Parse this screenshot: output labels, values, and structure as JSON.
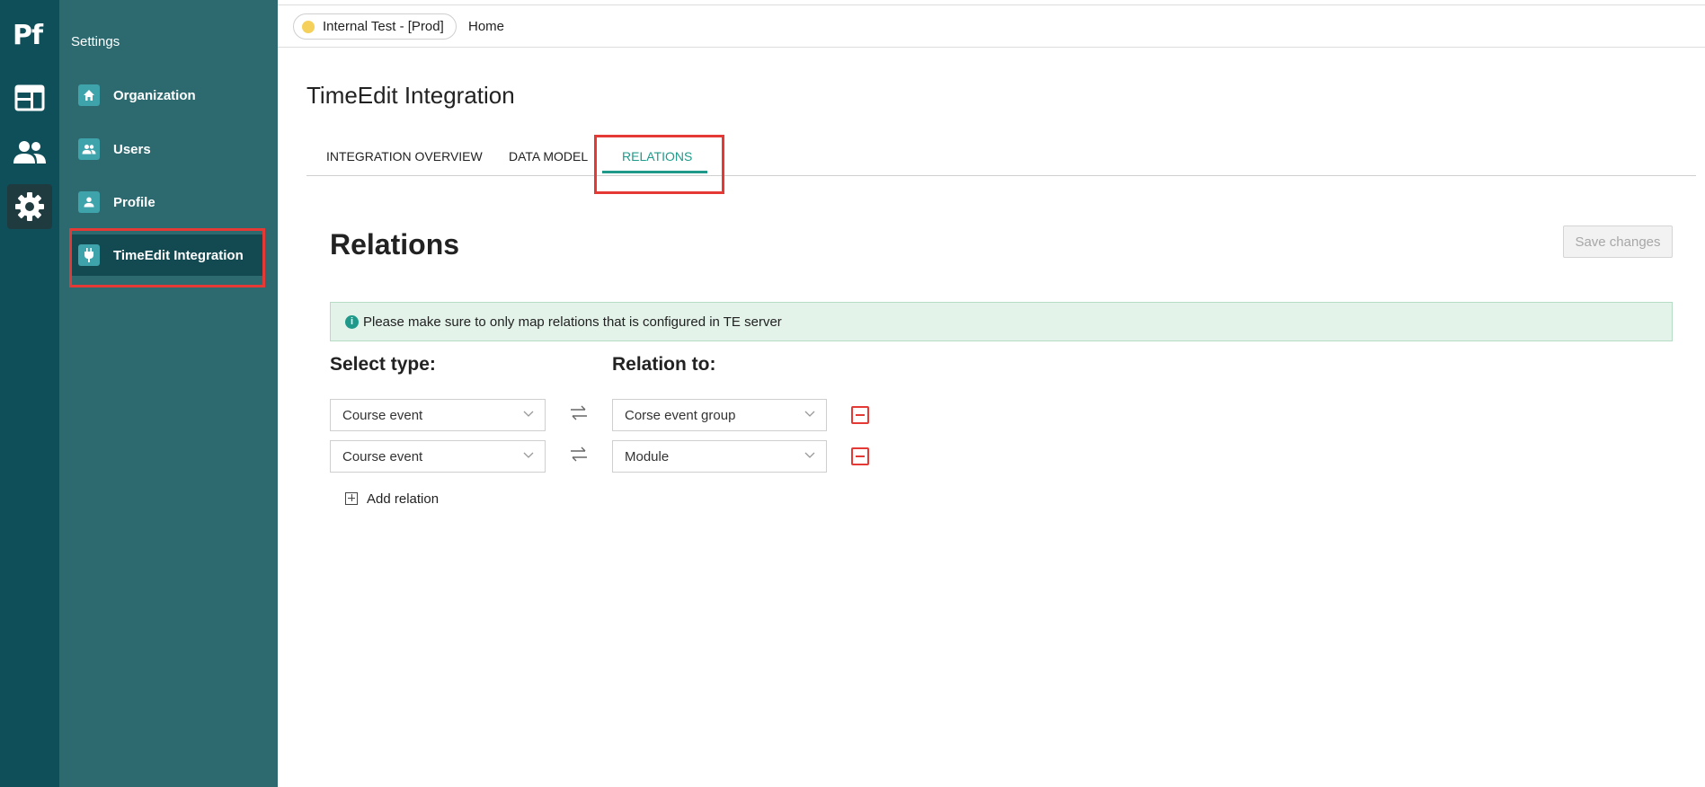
{
  "rail": {
    "logo": "Pf",
    "items": [
      {
        "icon": "dashboard-icon"
      },
      {
        "icon": "people-icon"
      },
      {
        "icon": "gear-icon"
      }
    ]
  },
  "sidebar": {
    "title": "Settings",
    "items": [
      {
        "label": "Organization",
        "icon": "home-icon"
      },
      {
        "label": "Users",
        "icon": "users-icon"
      },
      {
        "label": "Profile",
        "icon": "person-icon"
      },
      {
        "label": "TimeEdit Integration",
        "icon": "plug-icon"
      }
    ]
  },
  "topbar": {
    "environment": "Internal Test - [Prod]",
    "breadcrumb": "Home"
  },
  "page": {
    "title": "TimeEdit Integration",
    "tabs": [
      {
        "label": "INTEGRATION OVERVIEW"
      },
      {
        "label": "DATA MODEL"
      },
      {
        "label": "RELATIONS"
      }
    ],
    "active_tab": "RELATIONS"
  },
  "relations": {
    "title": "Relations",
    "save_label": "Save changes",
    "info": "Please make sure to only map relations that is configured in TE server",
    "select_type_label": "Select type:",
    "relation_to_label": "Relation to:",
    "rows": [
      {
        "type": "Course event",
        "relation": "Corse event group"
      },
      {
        "type": "Course event",
        "relation": "Module"
      }
    ],
    "add_label": "Add relation"
  },
  "colors": {
    "rail": "#0e4f59",
    "sidebar": "#2c6a70",
    "accent": "#1f9a8a",
    "highlight": "#e53935",
    "info_bg": "#e3f3ea"
  }
}
